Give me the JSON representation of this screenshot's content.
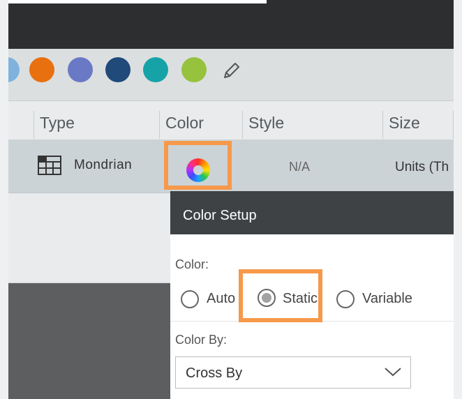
{
  "palette": {
    "swatches": [
      {
        "name": "light-blue",
        "color": "#7fb3dd"
      },
      {
        "name": "orange",
        "color": "#e8700f"
      },
      {
        "name": "periwinkle",
        "color": "#6a79c6"
      },
      {
        "name": "navy",
        "color": "#1f4a7a"
      },
      {
        "name": "teal",
        "color": "#16a3a8"
      },
      {
        "name": "yellow-green",
        "color": "#96c23e"
      }
    ],
    "edit_icon": "pencil-icon"
  },
  "grid": {
    "columns": [
      "Type",
      "Color",
      "Style",
      "Size"
    ],
    "row": {
      "type_icon": "mondrian-chart-icon",
      "type": "Mondrian",
      "color_icon": "color-wheel-icon",
      "style": "N/A",
      "size": "Units (Th"
    }
  },
  "color_setup": {
    "title": "Color Setup",
    "color_label": "Color:",
    "options": [
      "Auto",
      "Static",
      "Variable"
    ],
    "selected": "Static",
    "color_by_label": "Color By:",
    "color_by_value": "Cross By"
  },
  "highlight_color": "#f6994a"
}
